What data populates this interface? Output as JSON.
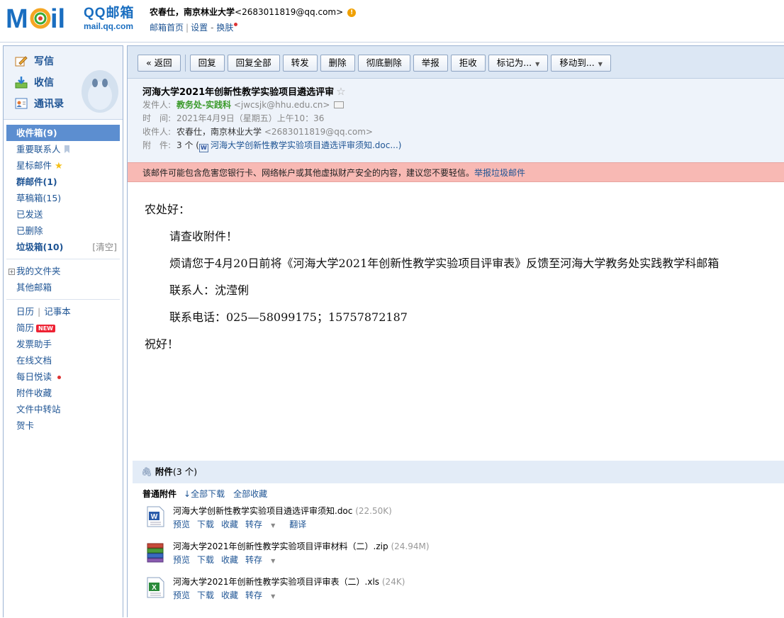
{
  "brand": {
    "logo_text": "MOil",
    "name": "QQ邮箱",
    "domain": "mail.qq.com",
    "colors": {
      "accent": "#1a6ec0",
      "selected": "#5c8ed0",
      "warning_bg": "#f8b9b4",
      "sender": "#3a9a2a"
    }
  },
  "account": {
    "name": "农春仕，南京林业大学",
    "email": "<2683011819@qq.com>",
    "links": [
      "邮箱首页",
      "设置",
      "换肤"
    ]
  },
  "sidebar": {
    "quick": [
      {
        "label": "写信",
        "icon": "compose-icon"
      },
      {
        "label": "收信",
        "icon": "inbox-download-icon"
      },
      {
        "label": "通讯录",
        "icon": "contacts-icon"
      }
    ],
    "folders": [
      {
        "label": "收件箱(9)"
      },
      {
        "label": "重要联系人"
      },
      {
        "label": "星标邮件"
      },
      {
        "label": "群邮件(1)"
      },
      {
        "label": "草稿箱(15)"
      },
      {
        "label": "已发送"
      },
      {
        "label": "已删除"
      },
      {
        "label": "垃圾箱(10)",
        "action": "[清空]"
      }
    ],
    "my_folders": "我的文件夹",
    "other_mailbox": "其他邮箱",
    "tools": {
      "calendar": "日历",
      "notebook": "记事本",
      "resume": "简历",
      "resume_badge": "NEW",
      "invoice": "发票助手",
      "docs": "在线文档",
      "daily": "每日悦读",
      "attach_fav": "附件收藏",
      "transfer": "文件中转站",
      "card": "贺卡"
    }
  },
  "toolbar": {
    "back": "« 返回",
    "reply": "回复",
    "reply_all": "回复全部",
    "forward": "转发",
    "delete": "删除",
    "delete_perm": "彻底删除",
    "report": "举报",
    "reject": "拒收",
    "mark_as": "标记为...",
    "move_to": "移动到..."
  },
  "mail": {
    "subject": "河海大学2021年创新性教学实验项目遴选评审",
    "from_label": "发件人:",
    "from_name": "教务处-实践科",
    "from_email": "<jwcsjk@hhu.edu.cn>",
    "time_label": "时　间:",
    "time": "2021年4月9日（星期五）上午10：36",
    "to_label": "收件人:",
    "to_name": "农春仕，南京林业大学",
    "to_email": "<2683011819@qq.com>",
    "attach_label": "附　件:",
    "attach_count": "3 个 (",
    "attach_first": "河海大学创新性教学实验项目遴选评审须知.doc...)",
    "warning": "该邮件可能包含危害您银行卡、网络帐户或其他虚拟财产安全的内容，建议您不要轻信。",
    "report_spam": "举报垃圾邮件",
    "body": [
      "农处好：",
      "请查收附件！",
      "烦请您于4月20日前将《河海大学2021年创新性教学实验项目评审表》反馈至河海大学教务处实践教学科邮箱",
      "联系人：沈滢俐",
      "联系电话：025—58099175；15757872187",
      "祝好！"
    ]
  },
  "attachments": {
    "title": "附件",
    "count": "(3 个)",
    "section": "普通附件",
    "download_all": "全部下载",
    "save_all": "全部收藏",
    "files": [
      {
        "name": "河海大学创新性教学实验项目遴选评审须知.doc",
        "size": "(22.50K)",
        "type": "doc",
        "ops": [
          "预览",
          "下载",
          "收藏",
          "转存",
          "翻译"
        ]
      },
      {
        "name": "河海大学2021年创新性教学实验项目评审材料（二）.zip",
        "size": "(24.94M)",
        "type": "zip",
        "ops": [
          "预览",
          "下载",
          "收藏",
          "转存"
        ]
      },
      {
        "name": "河海大学2021年创新性教学实验项目评审表（二）.xls",
        "size": "(24K)",
        "type": "xls",
        "ops": [
          "预览",
          "下载",
          "收藏",
          "转存"
        ]
      }
    ]
  }
}
